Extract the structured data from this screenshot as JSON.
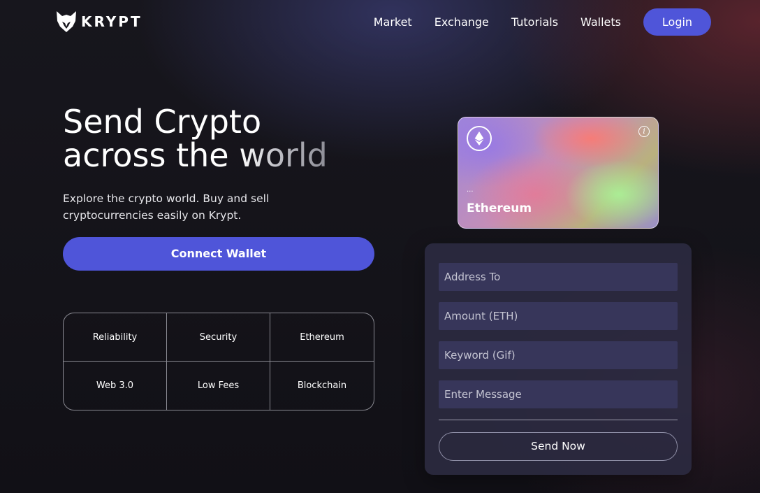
{
  "brand": {
    "name": "KRYPT",
    "logo_icon": "fox-head-icon"
  },
  "nav": {
    "links": [
      "Market",
      "Exchange",
      "Tutorials",
      "Wallets"
    ],
    "login_label": "Login"
  },
  "hero": {
    "title_line1": "Send Crypto",
    "title_line2_start": "across the",
    "title_line2_end": "world",
    "subtitle": "Explore the crypto world. Buy and sell cryptocurrencies easily on Krypt.",
    "connect_label": "Connect Wallet"
  },
  "features": [
    "Reliability",
    "Security",
    "Ethereum",
    "Web 3.0",
    "Low Fees",
    "Blockchain"
  ],
  "card": {
    "coin_icon": "ethereum-icon",
    "info_icon": "info-icon",
    "address": "...",
    "network": "Ethereum"
  },
  "form": {
    "address_placeholder": "Address To",
    "amount_placeholder": "Amount (ETH)",
    "keyword_placeholder": "Keyword (Gif)",
    "message_placeholder": "Enter Message",
    "submit_label": "Send Now"
  },
  "colors": {
    "accent": "#4f55d9",
    "form_panel": "#2c2b42",
    "field": "#37365a"
  }
}
